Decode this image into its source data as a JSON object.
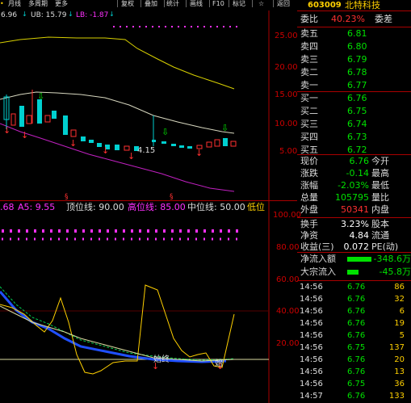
{
  "toolbar": {
    "items": [
      "月线",
      "多周期",
      "更多",
      "复权",
      "叠加",
      "统计",
      "画线",
      "F10",
      "标记",
      "☆",
      "返回"
    ]
  },
  "header": {
    "ma_label1": "6.96",
    "ub_label": "UB: 15.79",
    "lb_label": "LB: -1.87",
    "code": "603009",
    "name": "北特科技"
  },
  "axis": {
    "main_y_ticks": [
      "25.00",
      "20.00",
      "15.00",
      "10.00",
      "5.00"
    ],
    "ind_y_ticks": [
      "100.00",
      "80.00",
      "60.00",
      "40.00",
      "20.00"
    ],
    "price_label": "4.15"
  },
  "indicator": {
    "prefix": ".68",
    "a5": "A5: 9.55",
    "top_line": "顶位线: 90.00",
    "high_line": "高位线: 85.00",
    "mid_line": "中位线: 50.00",
    "low_line": "低位",
    "start_label1": "始终",
    "start_label2": "始"
  },
  "quote": {
    "weibi_label": "委比",
    "weibi_value": "40.23%",
    "weicha_label": "委差",
    "asks": [
      {
        "label": "卖五",
        "price": "6.81"
      },
      {
        "label": "卖四",
        "price": "6.80"
      },
      {
        "label": "卖三",
        "price": "6.79"
      },
      {
        "label": "卖二",
        "price": "6.78"
      },
      {
        "label": "卖一",
        "price": "6.77"
      }
    ],
    "bids": [
      {
        "label": "买一",
        "price": "6.76"
      },
      {
        "label": "买二",
        "price": "6.75"
      },
      {
        "label": "买三",
        "price": "6.74"
      },
      {
        "label": "买四",
        "price": "6.73"
      },
      {
        "label": "买五",
        "price": "6.72"
      }
    ],
    "stats": [
      {
        "l1": "现价",
        "v1": "6.76",
        "l2": "今开"
      },
      {
        "l1": "涨跌",
        "v1": "-0.14",
        "l2": "最高"
      },
      {
        "l1": "涨幅",
        "v1": "-2.03%",
        "l2": "最低"
      },
      {
        "l1": "总量",
        "v1": "105795",
        "l2": "量比"
      },
      {
        "l1": "外盘",
        "v1": "50341",
        "l2": "内盘"
      }
    ],
    "stats2": [
      {
        "l1": "换手",
        "v1": "3.23%",
        "l2": "股本"
      },
      {
        "l1": "净资",
        "v1": "4.84",
        "l2": "流通"
      },
      {
        "l1": "收益(三)",
        "v1": "0.072",
        "l2": "PE(动)"
      }
    ],
    "flow": [
      {
        "label": "净流入额",
        "value": "-348.6万"
      },
      {
        "label": "大宗流入",
        "value": "-45.8万"
      }
    ],
    "ticks": [
      {
        "time": "14:56",
        "price": "6.76",
        "vol": "86"
      },
      {
        "time": "14:56",
        "price": "6.76",
        "vol": "32"
      },
      {
        "time": "14:56",
        "price": "6.76",
        "vol": "6"
      },
      {
        "time": "14:56",
        "price": "6.76",
        "vol": "19"
      },
      {
        "time": "14:56",
        "price": "6.76",
        "vol": "5"
      },
      {
        "time": "14:56",
        "price": "6.75",
        "vol": "137"
      },
      {
        "time": "14:56",
        "price": "6.76",
        "vol": "20"
      },
      {
        "time": "14:56",
        "price": "6.76",
        "vol": "13"
      },
      {
        "time": "14:56",
        "price": "6.75",
        "vol": "36"
      },
      {
        "time": "14:57",
        "price": "6.76",
        "vol": "133"
      }
    ]
  },
  "colors": {
    "up": "#ff3030",
    "down": "#00d0d0",
    "green": "#00e000",
    "yellow": "#ffd000",
    "magenta": "#ff30ff"
  }
}
